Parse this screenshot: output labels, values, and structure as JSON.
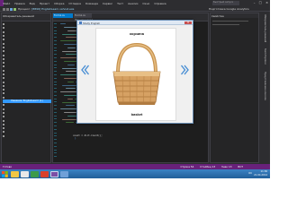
{
  "ide": {
    "menu": [
      "Файл",
      "Правка",
      "Вид",
      "Проект",
      "Сборка",
      "Отладка",
      "Команда",
      "Сервис",
      "Тест",
      "Анализ",
      "Окно",
      "Справка"
    ],
    "search_placeholder": "Быстрый запуск",
    "toolbar_label_prefix": "Процесс:",
    "toolbar_label_value": "[8896] EnglishLearn.vshost.exe",
    "toolbar_right": "Подготовка Google Analytics",
    "solution_header": "Обозреватель решений",
    "properties_header": "Свойства",
    "tab_active": "Form1.cs",
    "tab_inactive": "Form1.cs [Конструктор]",
    "selected_item": "Решение 'EnglishLearn' (1)",
    "side_tabs": [
      "Обозреватель решений",
      "Team Explorer",
      "Представление классов"
    ],
    "code_line_1": "count = dict.Count();",
    "code_line_2": "}",
    "statusbar_left": "Готово",
    "statusbar_right": [
      "Строка 54",
      "Столбец 13",
      "Знак 13",
      "ВСТ"
    ],
    "colors": {
      "accent": "#007acc",
      "status": "#68217a",
      "selection": "#3399ff"
    }
  },
  "dialog": {
    "title": "Study English",
    "close_glyph": "✕",
    "word_ru": "корзина",
    "word_en": "basket",
    "prev_icon": "chevron-left-double",
    "next_icon": "chevron-right-double",
    "image": "basket-picture"
  },
  "taskbar": {
    "time": "11:36",
    "date": "21.04.2014",
    "tray_lang": "RU"
  }
}
